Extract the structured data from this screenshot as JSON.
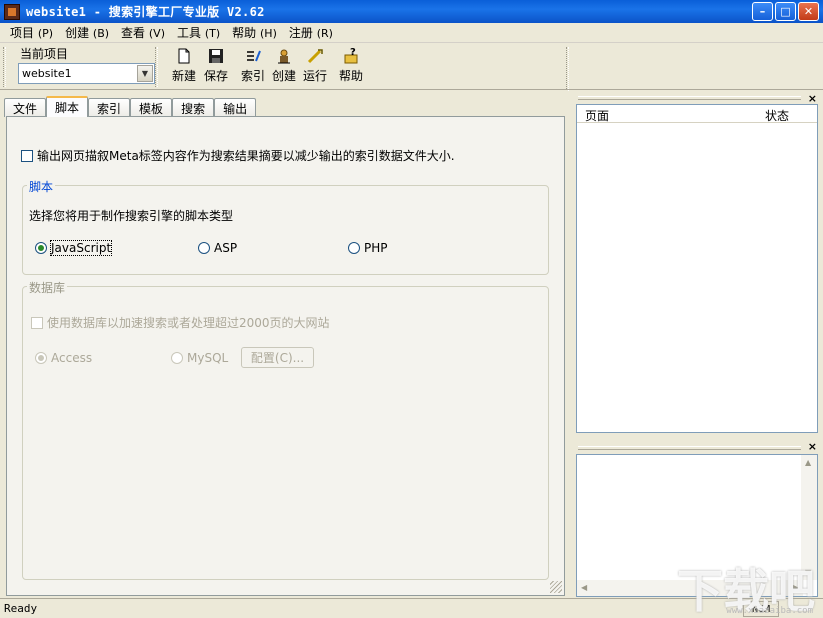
{
  "window": {
    "title": "website1 - 搜索引擎工厂专业版 V2.62",
    "min_glyph": "–",
    "max_glyph": "□",
    "close_glyph": "✕"
  },
  "menu": [
    {
      "label": "项目",
      "accel": "(P)"
    },
    {
      "label": "创建",
      "accel": "(B)"
    },
    {
      "label": "查看",
      "accel": "(V)"
    },
    {
      "label": "工具",
      "accel": "(T)"
    },
    {
      "label": "帮助",
      "accel": "(H)"
    },
    {
      "label": "注册",
      "accel": "(R)"
    }
  ],
  "project": {
    "label": "当前项目",
    "selected": "website1"
  },
  "toolbar": {
    "new": {
      "label": "新建",
      "icon": "new-file-icon"
    },
    "save": {
      "label": "保存",
      "icon": "floppy-disk-icon"
    },
    "index": {
      "label": "索引",
      "icon": "index-icon"
    },
    "build": {
      "label": "创建",
      "icon": "build-icon"
    },
    "run": {
      "label": "运行",
      "icon": "run-icon"
    },
    "help": {
      "label": "帮助",
      "icon": "help-icon"
    }
  },
  "tabs": [
    "文件",
    "脚本",
    "索引",
    "模板",
    "搜索",
    "输出"
  ],
  "active_tab": "脚本",
  "script_tab": {
    "meta_checkbox": "输出网页描叙Meta标签内容作为搜索结果摘要以减少输出的索引数据文件大小.",
    "script_group": {
      "title": "脚本",
      "prompt": "选择您将用于制作搜索引擎的脚本类型",
      "options": [
        "JavaScript",
        "ASP",
        "PHP"
      ],
      "selected": "JavaScript"
    },
    "db_group": {
      "title": "数据库",
      "checkbox": "使用数据库以加速搜索或者处理超过2000页的大网站",
      "options": [
        "Access",
        "MySQL"
      ],
      "selected": "Access",
      "config_button": "配置(C)..."
    }
  },
  "right_panel": {
    "columns": [
      "页面",
      "状态"
    ],
    "close_glyph": "×"
  },
  "status": {
    "text": "Ready",
    "num": "NUM"
  },
  "watermark": {
    "text": "下载吧",
    "sub": "www.xiazaiba.com"
  },
  "colors": {
    "titlebar": "#0a5fd8",
    "group_title": "#0046d5",
    "window_bg": "#ece9d8"
  }
}
